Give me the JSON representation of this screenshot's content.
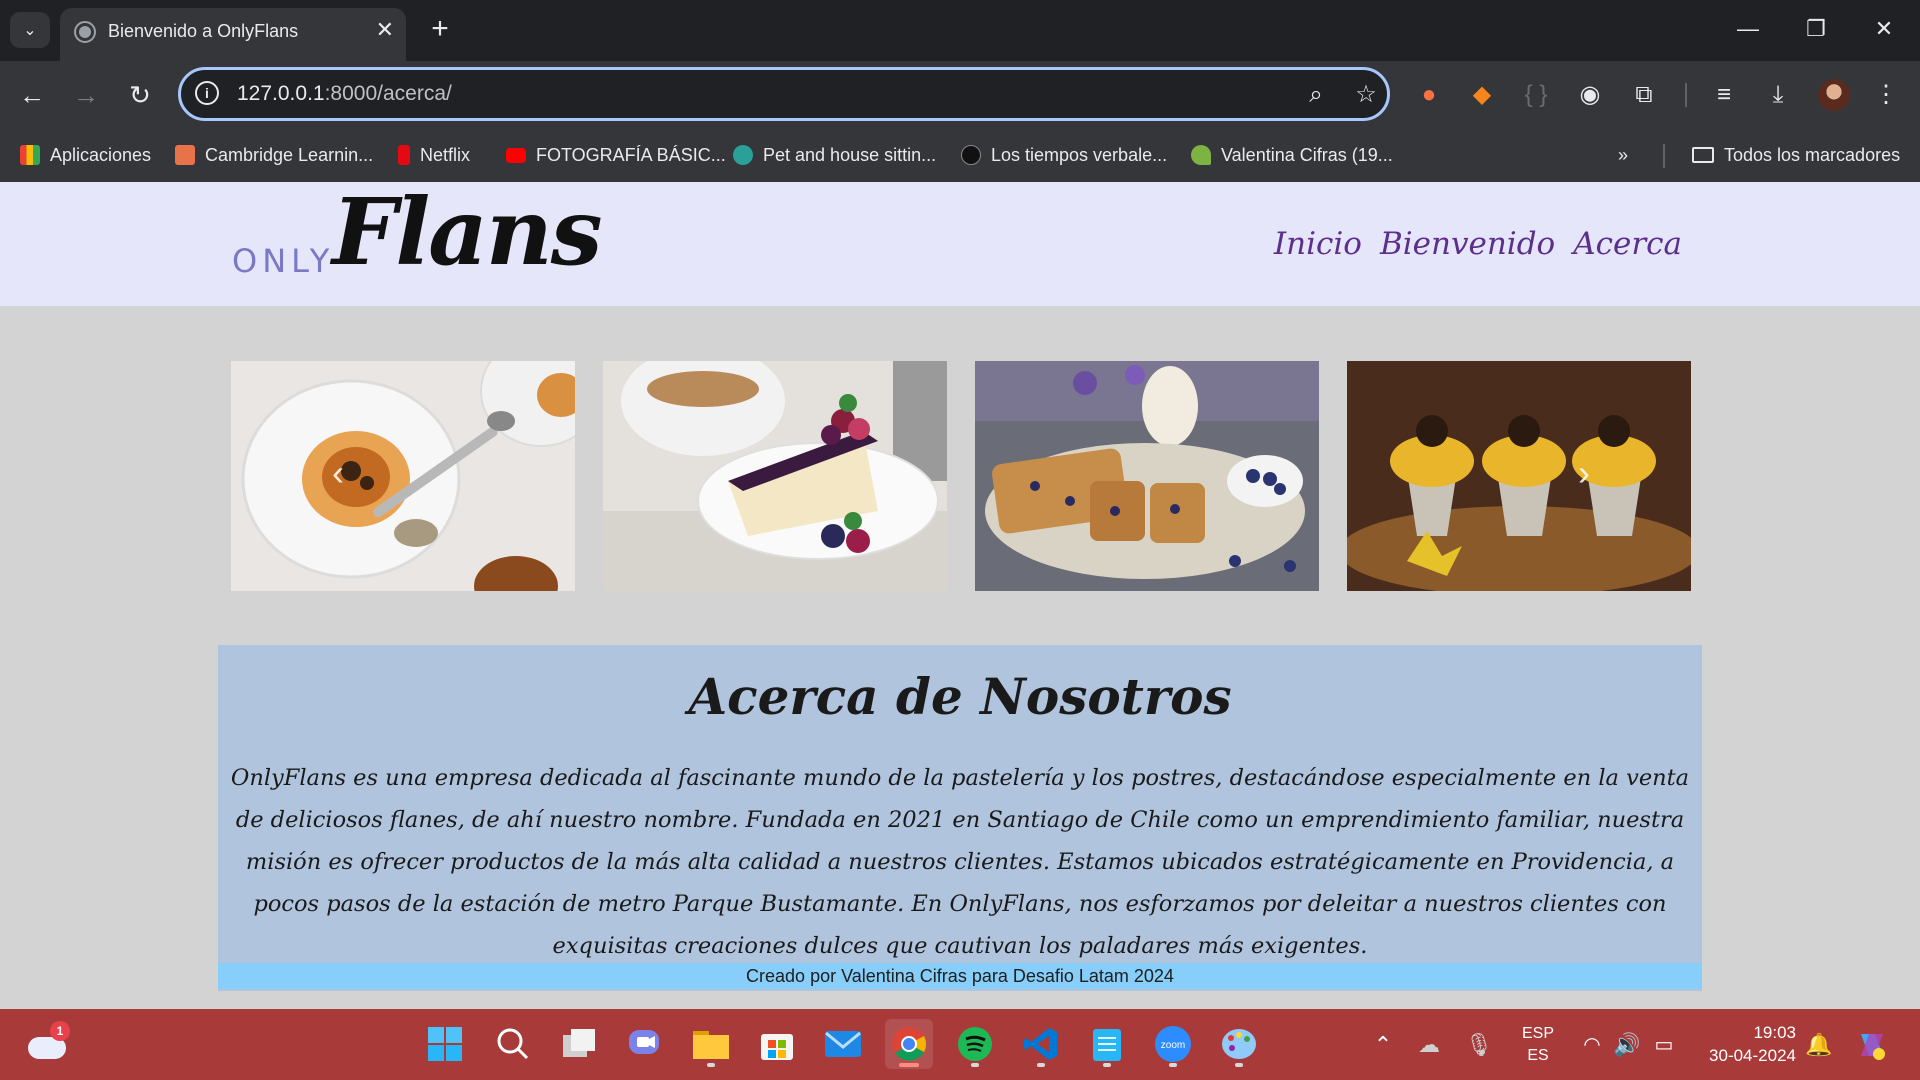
{
  "browser": {
    "tab_title": "Bienvenido a OnlyFlans",
    "url_host": "127.0.0.1",
    "url_path": ":8000/acerca/",
    "bookmarks": [
      {
        "label": "Aplicaciones",
        "color": "#4285f4"
      },
      {
        "label": "Cambridge Learnin...",
        "color": "#e8734a"
      },
      {
        "label": "Netflix",
        "color": "#e50914"
      },
      {
        "label": "FOTOGRAFÍA BÁSIC...",
        "color": "#ff0000"
      },
      {
        "label": "Pet and house sittin...",
        "color": "#2aa198"
      },
      {
        "label": "Los tiempos verbale...",
        "color": "#222222"
      },
      {
        "label": "Valentina Cifras (19...",
        "color": "#7cb342"
      }
    ],
    "all_bookmarks": "Todos los marcadores"
  },
  "site": {
    "logo_only": "ONLY",
    "logo_flans": "Flans",
    "nav": [
      "Inicio",
      "Bienvenido",
      "Acerca"
    ],
    "about_title": "Acerca de Nosotros",
    "about_text": "OnlyFlans es una empresa dedicada al fascinante mundo de la pastelería y los postres, destacándose especialmente en la venta de deliciosos flanes, de ahí nuestro nombre. Fundada en 2021 en Santiago de Chile como un emprendimiento familiar, nuestra misión es ofrecer productos de la más alta calidad a nuestros clientes. Estamos ubicados estratégicamente en Providencia, a pocos pasos de la estación de metro Parque Bustamante. En OnlyFlans, nos esforzamos por deleitar a nuestros clientes con exquisitas creaciones dulces que cautivan los paladares más exigentes.",
    "footer": "Creado por Valentina Cifras para Desafio Latam 2024",
    "colors": {
      "header_bg": "#e6e6fa",
      "page_bg": "#d3d3d3",
      "about_bg": "#b0c4de",
      "footer_bg": "#87cefa",
      "nav": "#5b2f8a"
    }
  },
  "taskbar": {
    "weather_badge": "1",
    "lang_top": "ESP",
    "lang_bottom": "ES",
    "time": "19:03",
    "date": "30-04-2024"
  }
}
